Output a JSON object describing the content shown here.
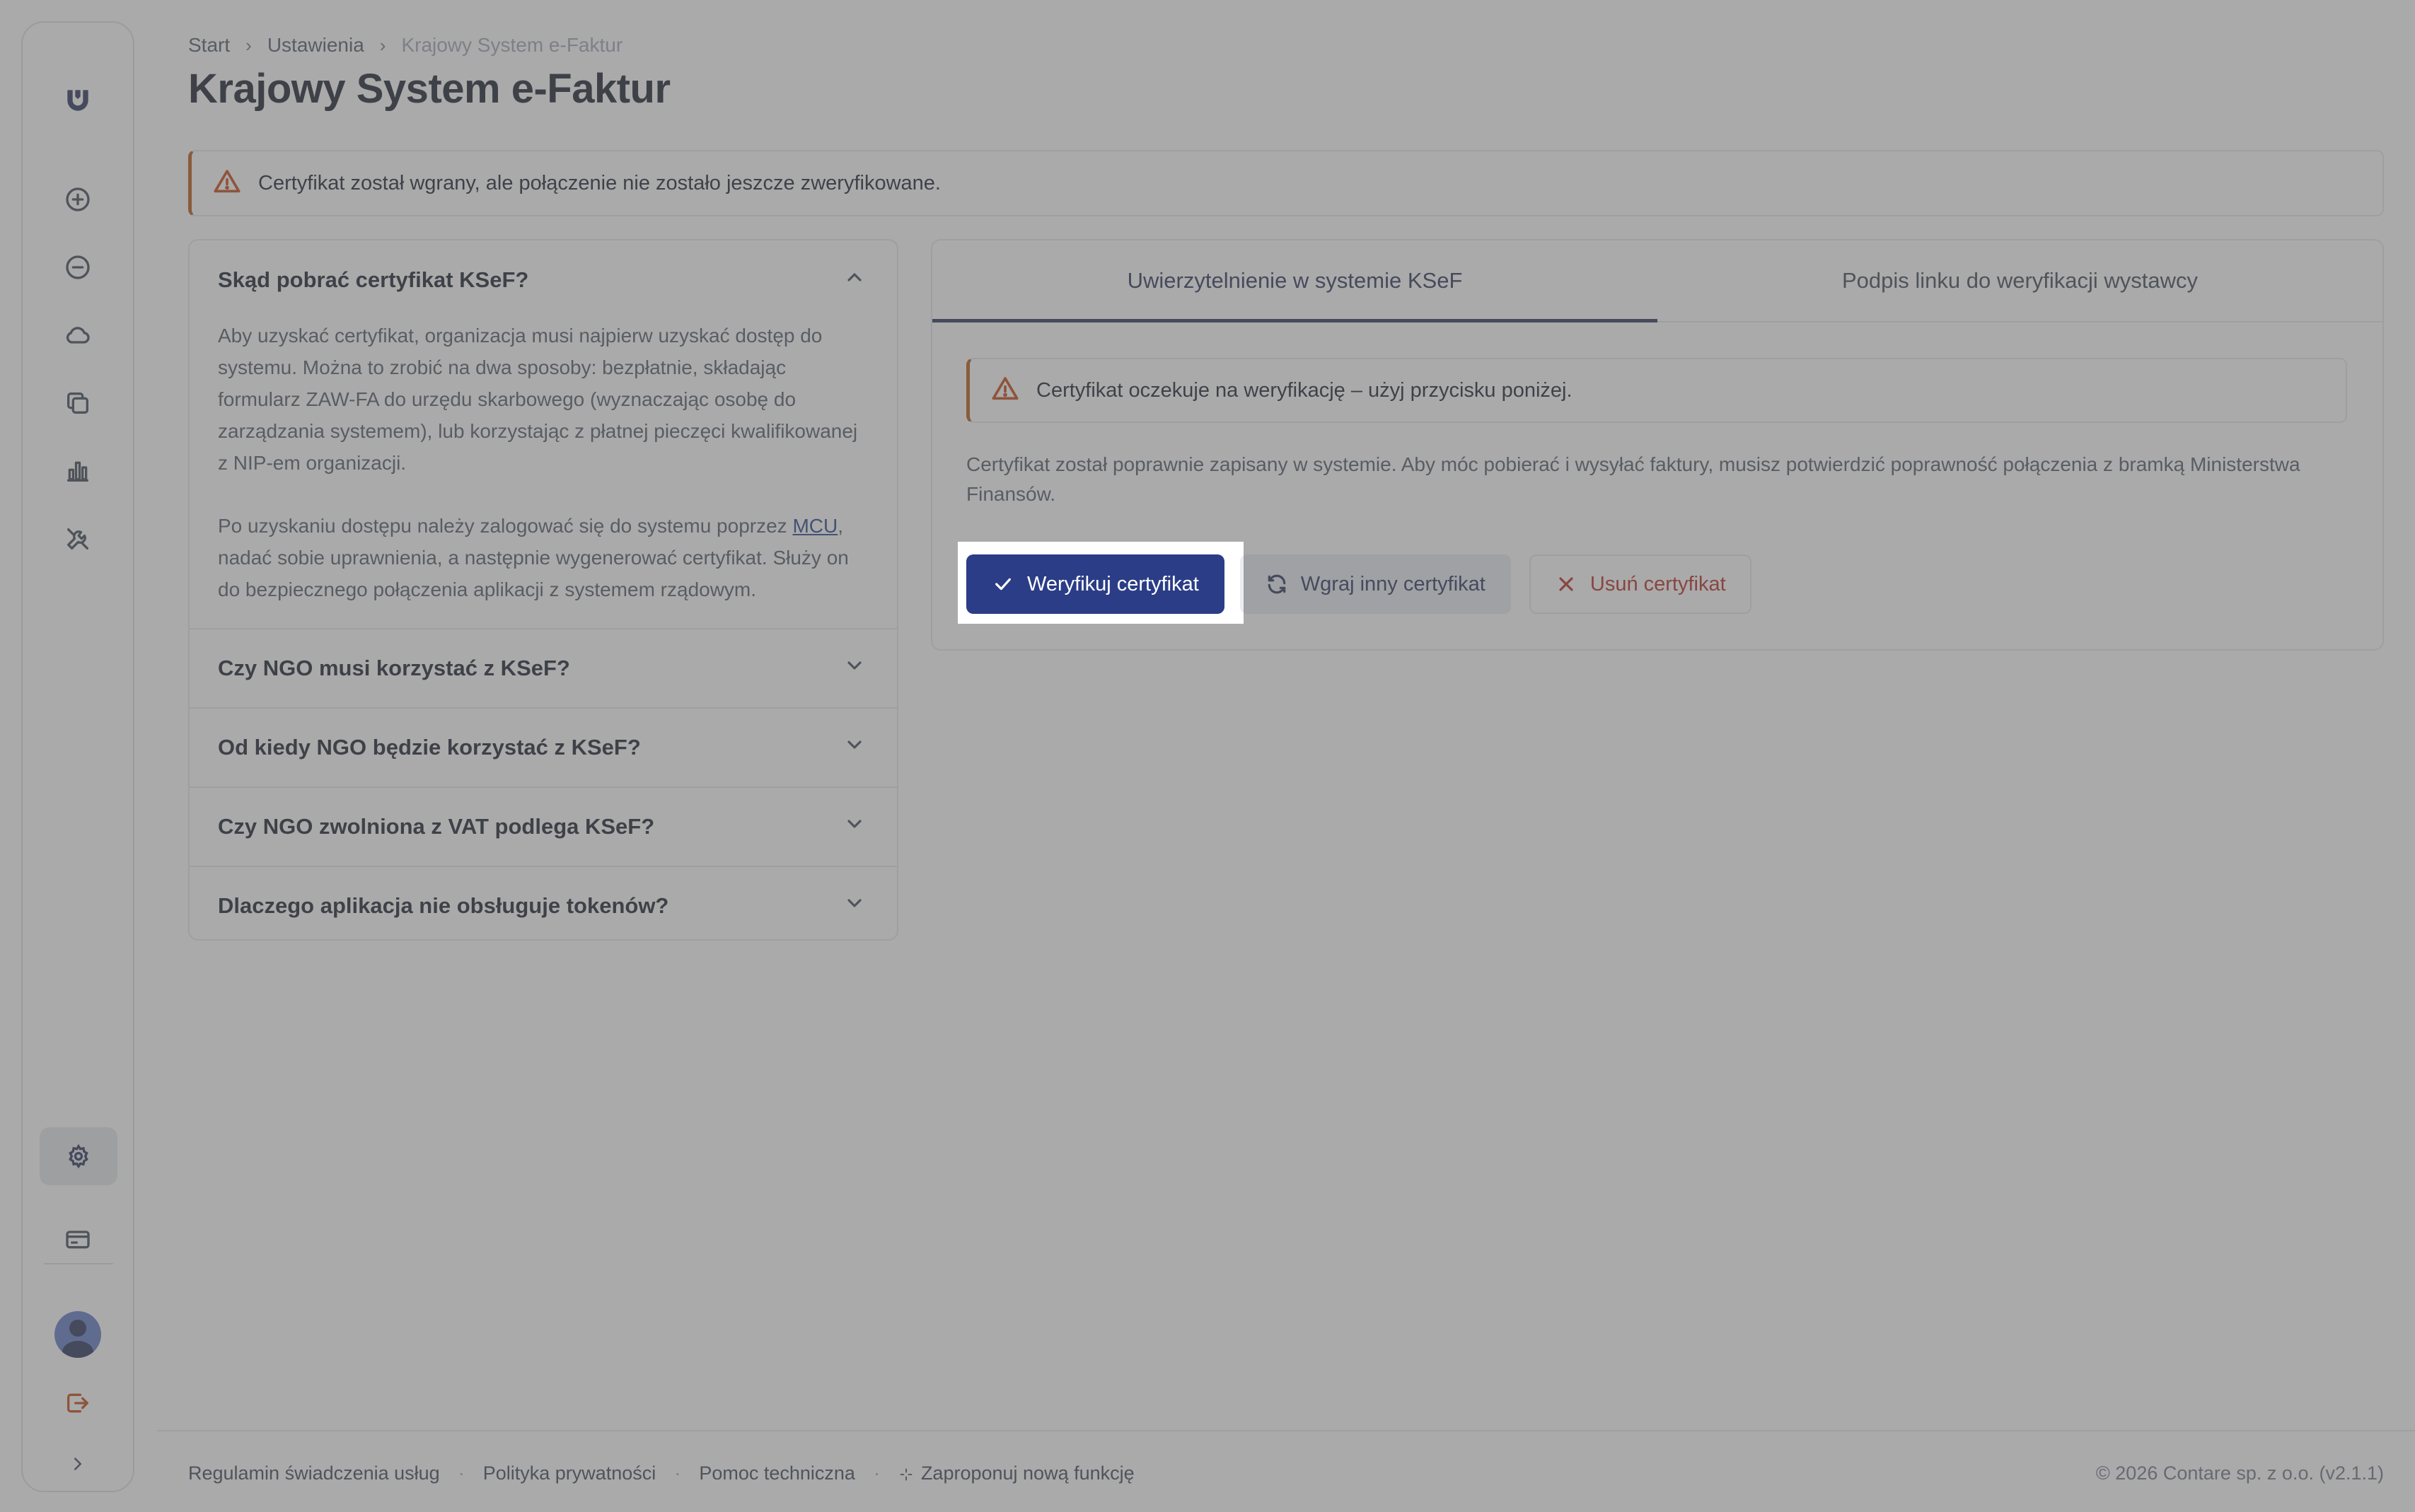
{
  "sidebar": {
    "items": [
      {
        "name": "logo",
        "icon": "brand-logo-icon"
      },
      {
        "name": "add",
        "icon": "plus-circle-icon"
      },
      {
        "name": "subtract",
        "icon": "minus-circle-icon"
      },
      {
        "name": "cloud",
        "icon": "cloud-icon"
      },
      {
        "name": "documents",
        "icon": "copy-icon"
      },
      {
        "name": "reports",
        "icon": "bar-chart-icon"
      },
      {
        "name": "tools",
        "icon": "tools-icon"
      },
      {
        "name": "settings",
        "icon": "gear-icon",
        "active": true
      },
      {
        "name": "billing",
        "icon": "credit-card-icon"
      },
      {
        "name": "profile",
        "icon": "user-avatar"
      },
      {
        "name": "logout",
        "icon": "logout-icon"
      },
      {
        "name": "expand",
        "icon": "chevron-right-icon"
      }
    ]
  },
  "breadcrumb": {
    "items": [
      "Start",
      "Ustawienia",
      "Krajowy System e-Faktur"
    ]
  },
  "page": {
    "title": "Krajowy System e-Faktur"
  },
  "alert_top": {
    "text": "Certyfikat został wgrany, ale połączenie nie zostało jeszcze zweryfikowane."
  },
  "faq": {
    "open": {
      "question": "Skąd pobrać certyfikat KSeF?",
      "paragraph1": "Aby uzyskać certyfikat, organizacja musi najpierw uzyskać dostęp do systemu. Można to zrobić na dwa sposoby: bezpłatnie, składając formularz ZAW-FA do urzędu skarbowego (wyznaczając osobę do zarządzania systemem), lub korzystając z płatnej pieczęci kwalifikowanej z NIP-em organizacji.",
      "paragraph2_before": "Po uzyskaniu dostępu należy zalogować się do systemu poprzez ",
      "paragraph2_link": "MCU",
      "paragraph2_after": ", nadać sobie uprawnienia, a następnie wygenerować certyfikat. Służy on do bezpiecznego połączenia aplikacji z systemem rządowym."
    },
    "closed": [
      "Czy NGO musi korzystać z KSeF?",
      "Od kiedy NGO będzie korzystać z KSeF?",
      "Czy NGO zwolniona z VAT podlega KSeF?",
      "Dlaczego aplikacja nie obsługuje tokenów?"
    ]
  },
  "card": {
    "tabs": [
      "Uwierzytelnienie w systemie KSeF",
      "Podpis linku do weryfikacji wystawcy"
    ],
    "alert": "Certyfikat oczekuje na weryfikację – użyj przycisku poniżej.",
    "description": "Certyfikat został poprawnie zapisany w systemie. Aby móc pobierać i wysyłać faktury, musisz potwierdzić poprawność połączenia z bramką Ministerstwa Finansów.",
    "buttons": {
      "verify": "Weryfikuj certyfikat",
      "upload": "Wgraj inny certyfikat",
      "delete": "Usuń certyfikat"
    }
  },
  "footer": {
    "links": [
      "Regulamin świadczenia usług",
      "Polityka prywatności",
      "Pomoc techniczna",
      "Zaproponuj nową funkcję"
    ],
    "copyright": "© 2026 Contare sp. z o.o. (v2.1.1)"
  },
  "colors": {
    "primary": "#2b3d86",
    "navy": "#1f2a52",
    "warning": "#c2410c",
    "danger": "#b42318"
  }
}
